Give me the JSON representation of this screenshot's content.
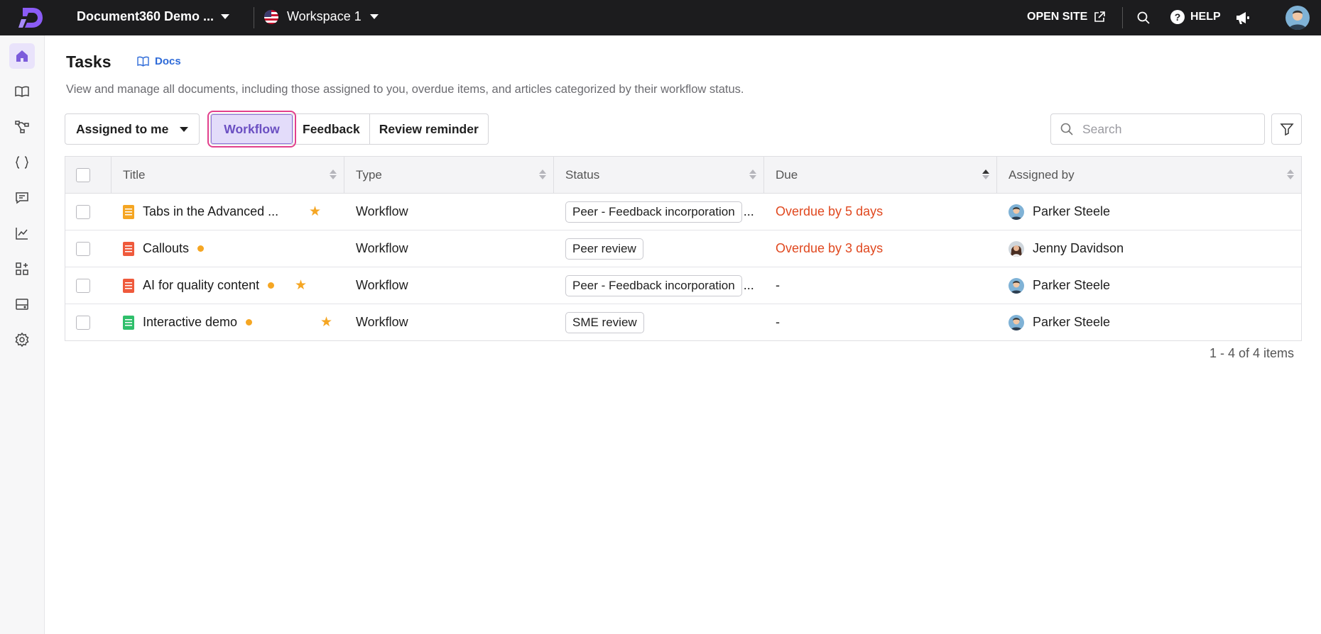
{
  "topbar": {
    "project_name": "Document360 Demo ...",
    "workspace_name": "Workspace 1",
    "open_site_label": "OPEN SITE",
    "help_label": "HELP"
  },
  "sidebar": {
    "items": [
      {
        "icon": "home-icon",
        "active": true
      },
      {
        "icon": "book-icon"
      },
      {
        "icon": "category-tree-icon"
      },
      {
        "icon": "code-braces-icon"
      },
      {
        "icon": "comment-icon"
      },
      {
        "icon": "analytics-icon"
      },
      {
        "icon": "apps-icon"
      },
      {
        "icon": "drive-icon"
      },
      {
        "icon": "settings-icon"
      }
    ]
  },
  "page": {
    "title": "Tasks",
    "docs_link": "Docs",
    "subtitle": "View and manage all documents, including those assigned to you, overdue items, and articles categorized by their workflow status."
  },
  "controls": {
    "assigned_dropdown": "Assigned to me",
    "tabs": [
      "Workflow",
      "Feedback",
      "Review reminder"
    ],
    "active_tab": "Workflow",
    "search_placeholder": "Search"
  },
  "table": {
    "columns": [
      "Title",
      "Type",
      "Status",
      "Due",
      "Assigned by"
    ],
    "rows": [
      {
        "title": "Tabs in the Advanced ...",
        "icon_color": "#f5a623",
        "dot": false,
        "starred": true,
        "type": "Workflow",
        "status": "Peer - Feedback incorporation",
        "status_truncated": true,
        "due": "Overdue by 5 days",
        "overdue": true,
        "assigned_by": "Parker Steele"
      },
      {
        "title": "Callouts",
        "icon_color": "#ef5a3c",
        "dot": true,
        "starred": false,
        "type": "Workflow",
        "status": "Peer review",
        "status_truncated": false,
        "due": "Overdue by 3 days",
        "overdue": true,
        "assigned_by": "Jenny Davidson"
      },
      {
        "title": "AI for quality content",
        "icon_color": "#ef5a3c",
        "dot": true,
        "starred": true,
        "type": "Workflow",
        "status": "Peer - Feedback incorporation",
        "status_truncated": true,
        "due": "-",
        "overdue": false,
        "assigned_by": "Parker Steele"
      },
      {
        "title": "Interactive demo",
        "icon_color": "#2fbf6b",
        "dot": true,
        "starred": true,
        "type": "Workflow",
        "status": "SME review",
        "status_truncated": false,
        "due": "-",
        "overdue": false,
        "assigned_by": "Parker Steele"
      }
    ],
    "pagination": "1 - 4 of 4 items"
  },
  "colors": {
    "accent": "#6b4fc2",
    "highlight_outline": "#e2408c",
    "overdue": "#e0481f",
    "star": "#f5a623"
  }
}
